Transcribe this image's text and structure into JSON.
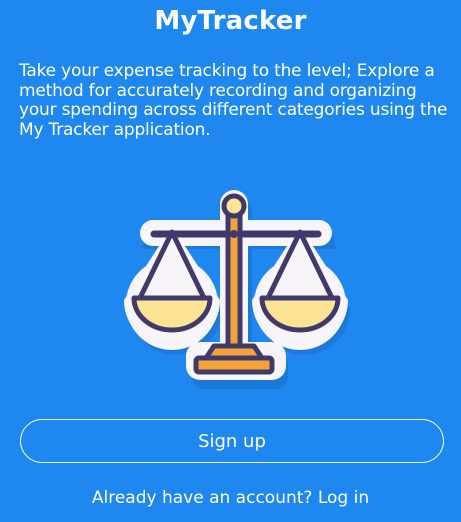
{
  "header": {
    "app_title": "MyTracker"
  },
  "intro": {
    "description": "Take your expense tracking to the level; Explore a method for accurately recording and organizing your spending across different categories using the My Tracker application."
  },
  "illustration": {
    "icon": "balance-scale-icon",
    "colors": {
      "outline": "#403a6b",
      "sticker": "#ffffff",
      "pans_fill": "#fde394",
      "pillar": "#f4a23a",
      "base": "#f4a23a"
    }
  },
  "actions": {
    "signup_label": "Sign up",
    "login_prompt": "Already have an account?",
    "login_label": "Log in"
  },
  "theme": {
    "background": "#1e88f0",
    "text": "#ffffff"
  }
}
